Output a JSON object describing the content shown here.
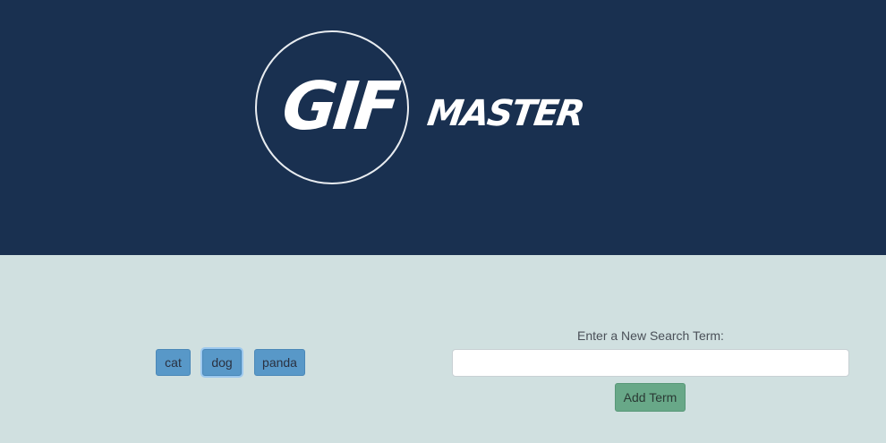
{
  "header": {
    "logo_main": "GIF",
    "logo_sub": "MASTER"
  },
  "terms": {
    "items": [
      {
        "label": "cat",
        "selected": false
      },
      {
        "label": "dog",
        "selected": true
      },
      {
        "label": "panda",
        "selected": false
      }
    ]
  },
  "form": {
    "prompt": "Enter a New Search Term:",
    "input_value": "",
    "add_label": "Add Term"
  },
  "colors": {
    "header_bg": "#193050",
    "main_bg": "#d0e0e0",
    "term_button": "#5898c8",
    "add_button": "#68a888"
  }
}
